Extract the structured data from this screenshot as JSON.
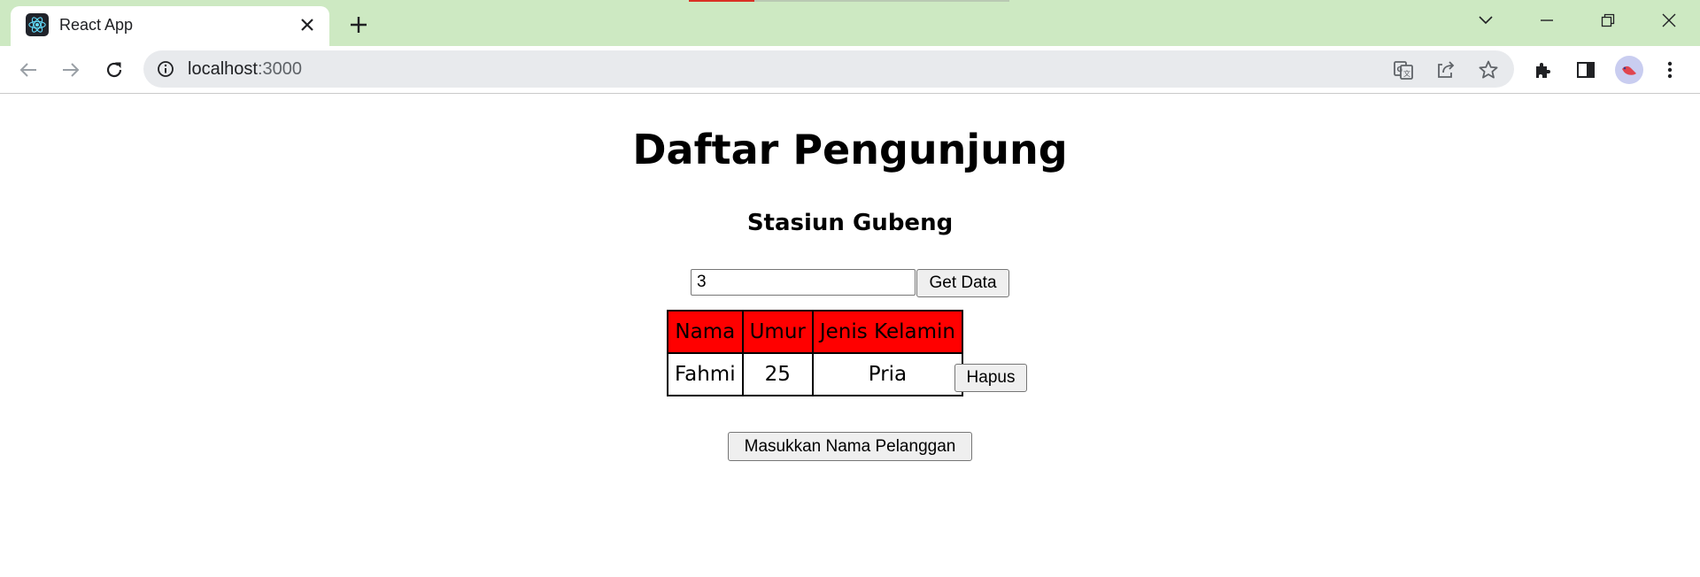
{
  "browser": {
    "tab_title": "React App",
    "url_host": "localhost",
    "url_port": ":3000",
    "icons": {
      "favicon": "react-logo-icon",
      "tab_close": "close-icon",
      "new_tab": "plus-icon",
      "back": "back-arrow-icon",
      "forward": "forward-arrow-icon",
      "reload": "reload-icon",
      "site_info": "info-icon",
      "translate": "translate-icon",
      "share": "share-icon",
      "bookmark": "star-icon",
      "extensions": "puzzle-icon",
      "side_panel": "side-panel-icon",
      "menu": "kebab-menu-icon"
    }
  },
  "page": {
    "title": "Daftar Pengunjung",
    "subtitle": "Stasiun Gubeng",
    "id_input_value": "3",
    "get_button": "Get Data",
    "table": {
      "headers": [
        "Nama",
        "Umur",
        "Jenis Kelamin"
      ],
      "rows": [
        {
          "nama": "Fahmi",
          "umur": "25",
          "jenis_kelamin": "Pria"
        }
      ],
      "header_color": "#ff0000"
    },
    "delete_button": "Hapus",
    "add_button": "Masukkan Nama Pelanggan"
  },
  "colors": {
    "titlebar": "#cde9c2",
    "omnibox": "#e8eaed"
  }
}
